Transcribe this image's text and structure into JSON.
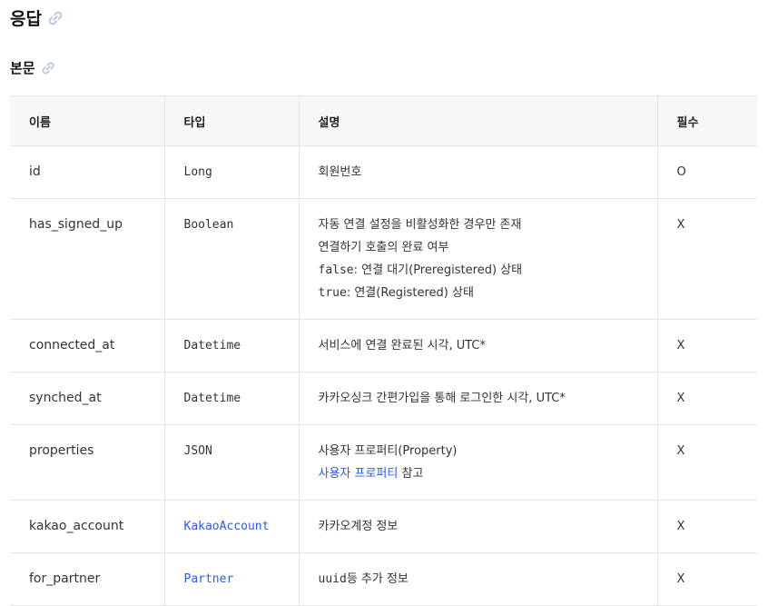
{
  "section": {
    "title": "응답",
    "anchor_icon": "link-icon"
  },
  "subsection": {
    "title": "본문",
    "anchor_icon": "link-icon"
  },
  "table": {
    "headers": {
      "name": "이름",
      "type": "타입",
      "desc": "설명",
      "required": "필수"
    },
    "rows": [
      {
        "name": "id",
        "type": "Long",
        "desc": [
          "회원번호"
        ],
        "required": "O"
      },
      {
        "name": "has_signed_up",
        "type": "Boolean",
        "desc_lines": {
          "l1": "자동 연결 설정을 비활성화한 경우만 존재",
          "l2": "연결하기 호출의 완료 여부",
          "l3_code": "false",
          "l3_text": ": 연결 대기(Preregistered) 상태",
          "l4_code": "true",
          "l4_text": ": 연결(Registered) 상태"
        },
        "required": "X"
      },
      {
        "name": "connected_at",
        "type": "Datetime",
        "desc": [
          "서비스에 연결 완료된 시각, UTC*"
        ],
        "required": "X"
      },
      {
        "name": "synched_at",
        "type": "Datetime",
        "desc": [
          "카카오싱크 간편가입을 통해 로그인한 시각, UTC*"
        ],
        "required": "X"
      },
      {
        "name": "properties",
        "type": "JSON",
        "desc_lines": {
          "l1": "사용자 프로퍼티(Property)",
          "l2_link": "사용자 프로퍼티",
          "l2_text": " 참고"
        },
        "required": "X"
      },
      {
        "name": "kakao_account",
        "type_link": "KakaoAccount",
        "desc": [
          "카카오계정 정보"
        ],
        "required": "X"
      },
      {
        "name": "for_partner",
        "type_link": "Partner",
        "desc_lines": {
          "code": "uuid",
          "text": "등 추가 정보"
        },
        "required": "X"
      }
    ]
  },
  "colors": {
    "link": "#2e5bde",
    "header_bg": "#f6f7f9",
    "border": "#e3e5e8"
  }
}
